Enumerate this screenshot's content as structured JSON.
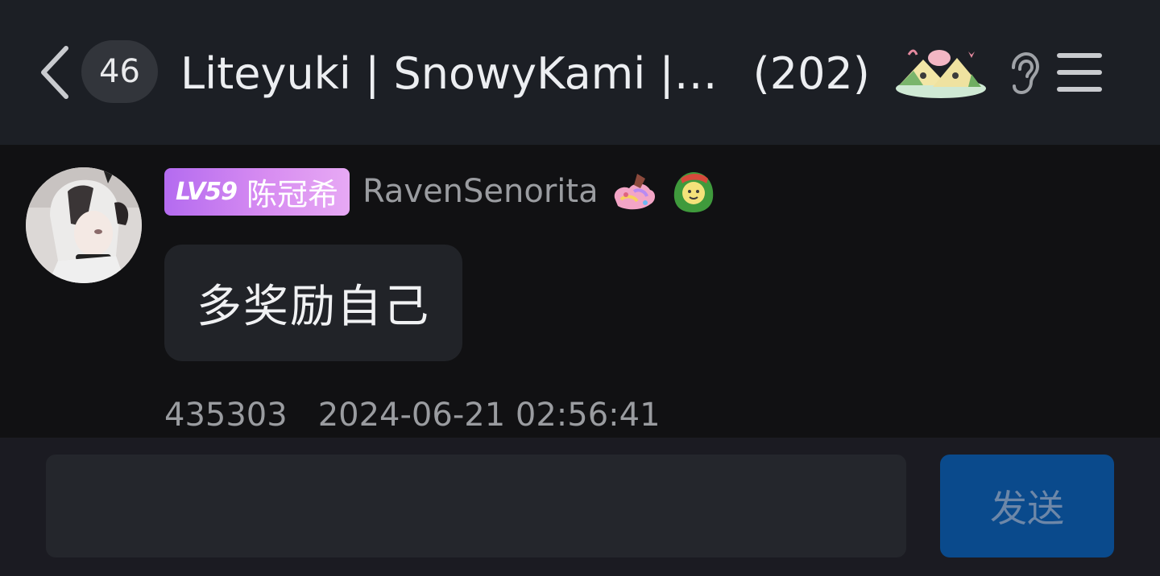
{
  "header": {
    "unread_count": "46",
    "group_name": "Liteyuki | SnowyKami |…",
    "member_count": "(202)",
    "icons": {
      "back": "chevron-left-icon",
      "festival": "zongzi-sticker-icon",
      "listen": "ear-icon",
      "menu": "hamburger-menu-icon"
    }
  },
  "message": {
    "avatar": "user-avatar",
    "level": "LV59",
    "member_title": "陈冠希",
    "sender": "RavenSenorita",
    "badges": [
      "colorful-sticker-icon",
      "green-zongzi-sticker-icon"
    ],
    "text": "多奖励自己",
    "message_id": "435303",
    "timestamp": "2024-06-21 02:56:41"
  },
  "composer": {
    "input_value": "",
    "send_label": "发送"
  },
  "colors": {
    "header_bg": "#1c1f25",
    "chat_bg": "#111113",
    "bubble_bg": "#212328",
    "send_button_bg": "#0a4a8c",
    "level_badge": "#c57cf0"
  }
}
